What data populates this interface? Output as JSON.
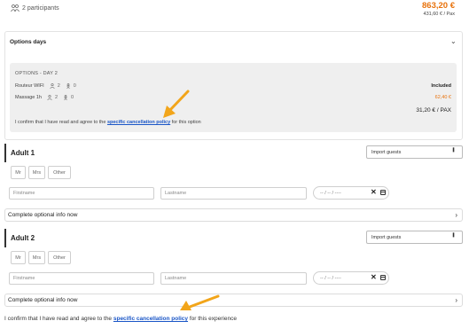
{
  "header": {
    "participants_icon": "people-icon",
    "participants_text": "2 participants",
    "price": "863,20 €",
    "price_per_pax": "431,60 € / Pax"
  },
  "options": {
    "title": "Options days",
    "inner_title": "OPTIONS - DAY 2",
    "rows": [
      {
        "label": "Routeur WIFI",
        "adults": "2",
        "children": "0",
        "price": "Included"
      },
      {
        "label": "Massage 1h",
        "adults": "2",
        "children": "0",
        "price": "62,40 €"
      }
    ],
    "total": "31,20 € / PAX",
    "confirm_prefix": "I confirm that I have read and agree to the ",
    "confirm_link": "specific cancellation policy",
    "confirm_suffix": " for this option"
  },
  "adults": [
    {
      "title": "Adult 1",
      "import_label": "Import guests",
      "titles": [
        "Mr",
        "Mrs",
        "Other"
      ],
      "firstname_placeholder": "Firstname",
      "lastname_placeholder": "Lastname",
      "date_placeholder": "-- / -- / ----",
      "optional_label": "Complete optional info now"
    },
    {
      "title": "Adult 2",
      "import_label": "Import guests",
      "titles": [
        "Mr",
        "Mrs",
        "Other"
      ],
      "firstname_placeholder": "Firstname",
      "lastname_placeholder": "Lastname",
      "date_placeholder": "-- / -- / ----",
      "optional_label": "Complete optional info now"
    }
  ],
  "confirm_main": {
    "prefix": "I confirm that I have read and agree to the ",
    "link": "specific cancellation policy",
    "suffix": " for this experience"
  },
  "colors": {
    "accent_orange": "#e8720c",
    "link_blue": "#1a56c7",
    "annotation_arrow": "#f2a51a"
  }
}
